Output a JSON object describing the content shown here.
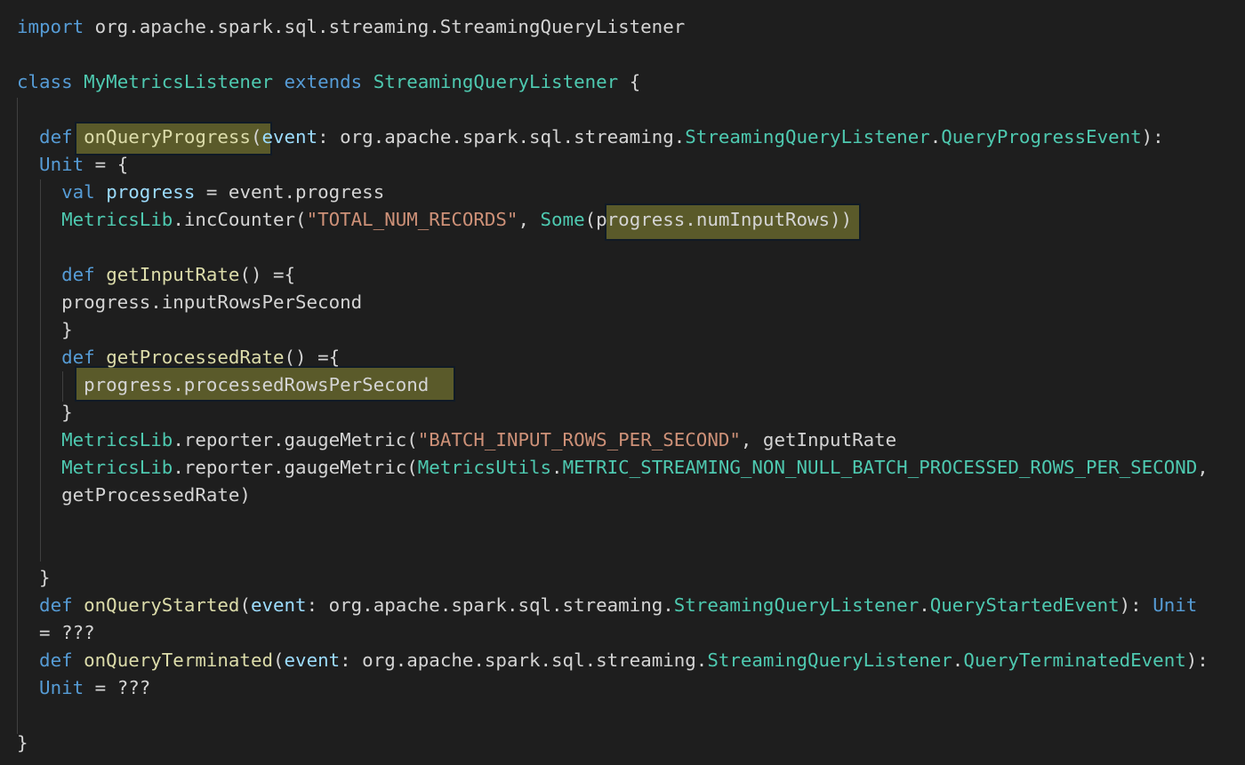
{
  "editor": {
    "colors": {
      "background": "#1e1e1e",
      "keyword": "#569cd6",
      "type": "#4ec9b0",
      "function": "#dcdcaa",
      "variable": "#9cdcfe",
      "string": "#ce9178",
      "default": "#d4d4d4",
      "highlight": "#5a5a2a",
      "indent_guide": "#404040"
    },
    "lines": [
      [
        [
          "import",
          "kw"
        ],
        [
          " org.apache.spark.sql.streaming.StreamingQueryListener",
          "df"
        ]
      ],
      [],
      [
        [
          "class",
          "kw"
        ],
        [
          " ",
          "df"
        ],
        [
          "MyMetricsListener",
          "ty"
        ],
        [
          " ",
          "df"
        ],
        [
          "extends",
          "kw"
        ],
        [
          " ",
          "df"
        ],
        [
          "StreamingQueryListener",
          "ty"
        ],
        [
          " {",
          "df"
        ]
      ],
      [],
      [
        [
          "  ",
          "df"
        ],
        [
          "def",
          "kw"
        ],
        [
          " ",
          "df"
        ],
        [
          "onQueryProgress",
          "fn"
        ],
        [
          "(",
          "df"
        ],
        [
          "event",
          "var"
        ],
        [
          ": org.apache.spark.sql.streaming.",
          "df"
        ],
        [
          "StreamingQueryListener",
          "ty"
        ],
        [
          ".",
          "df"
        ],
        [
          "QueryProgressEvent",
          "ty"
        ],
        [
          "):",
          "df"
        ]
      ],
      [
        [
          "  ",
          "df"
        ],
        [
          "Unit",
          "kw"
        ],
        [
          " = {",
          "df"
        ]
      ],
      [
        [
          "    ",
          "df"
        ],
        [
          "val",
          "kw"
        ],
        [
          " ",
          "df"
        ],
        [
          "progress",
          "var"
        ],
        [
          " = event.progress",
          "df"
        ]
      ],
      [
        [
          "    ",
          "df"
        ],
        [
          "MetricsLib",
          "ty"
        ],
        [
          ".incCounter(",
          "df"
        ],
        [
          "\"TOTAL_NUM_RECORDS\"",
          "str"
        ],
        [
          ", ",
          "df"
        ],
        [
          "Some",
          "ty"
        ],
        [
          "(progress.numInputRows))",
          "df"
        ]
      ],
      [],
      [
        [
          "    ",
          "df"
        ],
        [
          "def",
          "kw"
        ],
        [
          " ",
          "df"
        ],
        [
          "getInputRate",
          "fn"
        ],
        [
          "() ={",
          "df"
        ]
      ],
      [
        [
          "    progress.inputRowsPerSecond",
          "df"
        ]
      ],
      [
        [
          "    }",
          "df"
        ]
      ],
      [
        [
          "    ",
          "df"
        ],
        [
          "def",
          "kw"
        ],
        [
          " ",
          "df"
        ],
        [
          "getProcessedRate",
          "fn"
        ],
        [
          "() ={",
          "df"
        ]
      ],
      [
        [
          "      progress.processedRowsPerSecond",
          "df"
        ]
      ],
      [
        [
          "    }",
          "df"
        ]
      ],
      [
        [
          "    ",
          "df"
        ],
        [
          "MetricsLib",
          "ty"
        ],
        [
          ".reporter.gaugeMetric(",
          "df"
        ],
        [
          "\"BATCH_INPUT_ROWS_PER_SECOND\"",
          "str"
        ],
        [
          ", getInputRate",
          "df"
        ]
      ],
      [
        [
          "    ",
          "df"
        ],
        [
          "MetricsLib",
          "ty"
        ],
        [
          ".reporter.gaugeMetric(",
          "df"
        ],
        [
          "MetricsUtils",
          "ty"
        ],
        [
          ".",
          "df"
        ],
        [
          "METRIC_STREAMING_NON_NULL_BATCH_PROCESSED_ROWS_PER_SECOND",
          "ty"
        ],
        [
          ",",
          "df"
        ]
      ],
      [
        [
          "    getProcessedRate)",
          "df"
        ]
      ],
      [],
      [],
      [
        [
          "  }",
          "df"
        ]
      ],
      [
        [
          "  ",
          "df"
        ],
        [
          "def",
          "kw"
        ],
        [
          " ",
          "df"
        ],
        [
          "onQueryStarted",
          "fn"
        ],
        [
          "(",
          "df"
        ],
        [
          "event",
          "var"
        ],
        [
          ": org.apache.spark.sql.streaming.",
          "df"
        ],
        [
          "StreamingQueryListener",
          "ty"
        ],
        [
          ".",
          "df"
        ],
        [
          "QueryStartedEvent",
          "ty"
        ],
        [
          "): ",
          "df"
        ],
        [
          "Unit",
          "kw"
        ]
      ],
      [
        [
          "  = ???",
          "df"
        ]
      ],
      [
        [
          "  ",
          "df"
        ],
        [
          "def",
          "kw"
        ],
        [
          " ",
          "df"
        ],
        [
          "onQueryTerminated",
          "fn"
        ],
        [
          "(",
          "df"
        ],
        [
          "event",
          "var"
        ],
        [
          ": org.apache.spark.sql.streaming.",
          "df"
        ],
        [
          "StreamingQueryListener",
          "ty"
        ],
        [
          ".",
          "df"
        ],
        [
          "QueryTerminatedEvent",
          "ty"
        ],
        [
          "):",
          "df"
        ]
      ],
      [
        [
          "  ",
          "df"
        ],
        [
          "Unit",
          "kw"
        ],
        [
          " = ???",
          "df"
        ]
      ],
      [],
      [
        [
          "}",
          "df"
        ]
      ]
    ]
  }
}
